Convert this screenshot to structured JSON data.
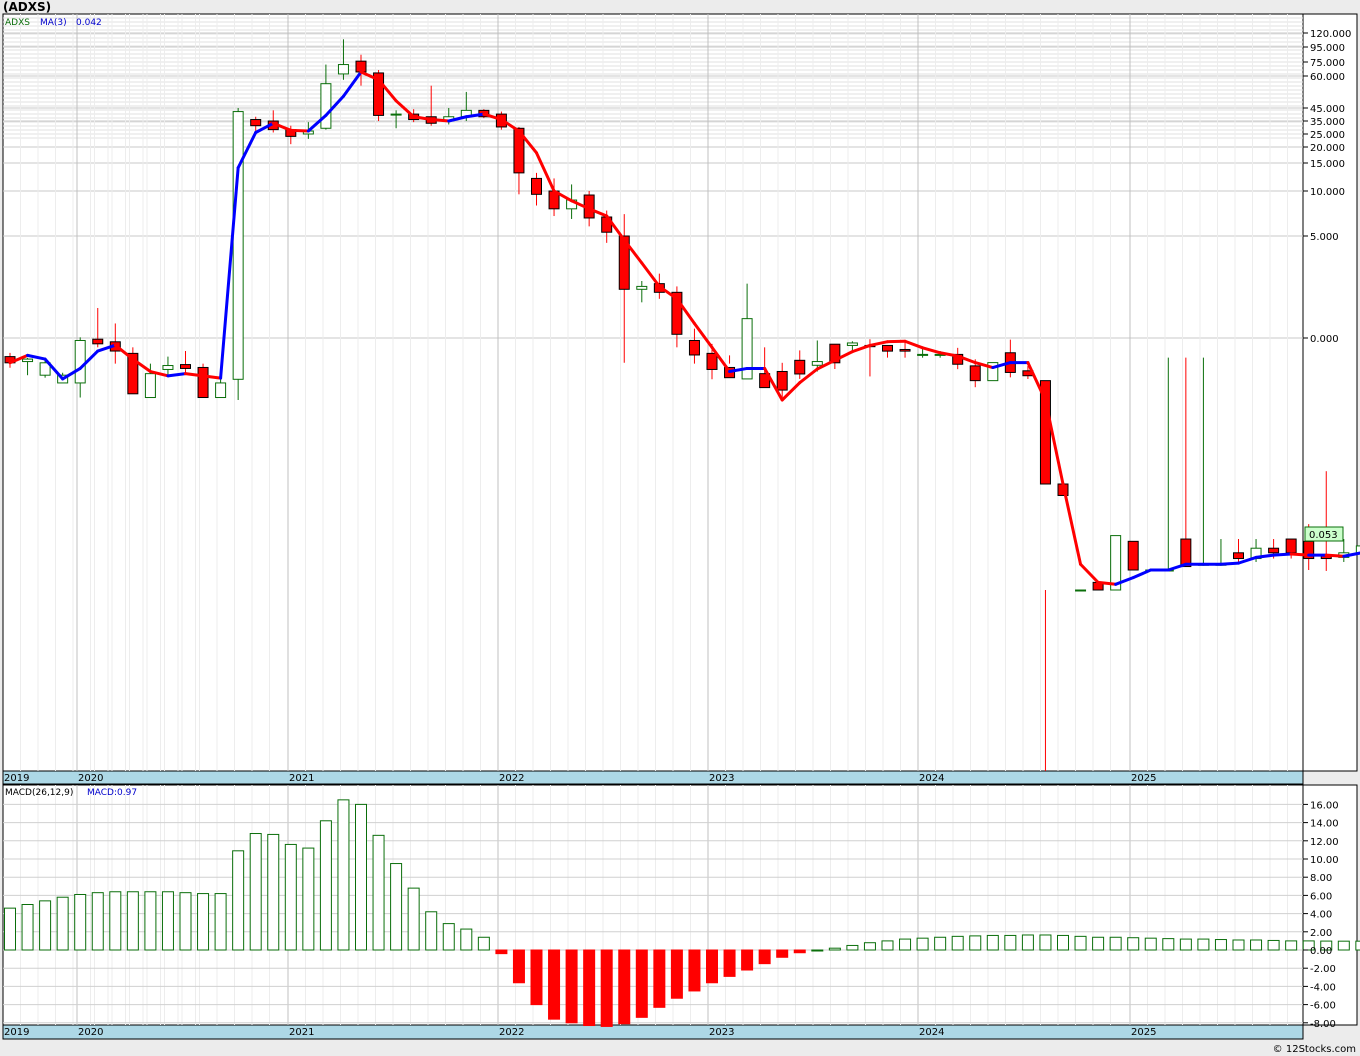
{
  "title": "(ADXS)",
  "footer": "© 12Stocks.com",
  "price_panel": {
    "legend_symbol": "ADXS",
    "legend_ma": "MA(3)",
    "legend_ma_value": "0.042",
    "last_price_label": "0.053",
    "y_tick_labels": [
      "120.000",
      "95.000",
      "75.000",
      "60.000",
      "45.000",
      "35.000",
      "25.000",
      "20.000",
      "15.000",
      "10.000",
      "5.000",
      "0.000"
    ],
    "x_year_labels": [
      "2019",
      "2020",
      "2021",
      "2022",
      "2023",
      "2024",
      "2025"
    ]
  },
  "macd_panel": {
    "legend": "MACD(26,12,9)",
    "legend_value": "MACD:0.97",
    "y_tick_labels": [
      "16.00",
      "14.00",
      "12.00",
      "10.00",
      "8.00",
      "6.00",
      "4.00",
      "2.00",
      "0.00",
      "-2.00",
      "-4.00",
      "-6.00",
      "-8.00"
    ],
    "x_year_labels": [
      "2019",
      "2020",
      "2021",
      "2022",
      "2023",
      "2024",
      "2025"
    ]
  },
  "colors": {
    "up": "#0a6e0a",
    "down": "#ff0000",
    "ma_up": "#0000ff",
    "ma_down": "#ff0000",
    "axis_band": "#add8e6",
    "grid": "#c0c0c0",
    "last_price_bg": "#ccffcc"
  },
  "chart_data": [
    {
      "type": "candlestick",
      "title": "(ADXS)",
      "scale": "log",
      "period": "monthly",
      "x_start": "2018-11",
      "overlay": "MA(3)",
      "series": [
        {
          "name": "ADXS",
          "ohlc": [
            [
              0.2,
              0.24,
              0.12,
              0.15
            ],
            [
              0.17,
              0.3,
              0.16,
              0.19
            ],
            [
              0.2,
              0.32,
              0.18,
              0.3
            ],
            [
              0.3,
              0.55,
              0.28,
              0.52
            ],
            [
              0.52,
              1.05,
              0.48,
              1.0
            ],
            [
              1.02,
              1.65,
              0.9,
              0.95
            ],
            [
              0.98,
              1.3,
              0.7,
              0.85
            ],
            [
              0.82,
              0.9,
              0.38,
              0.45
            ],
            [
              0.48,
              0.7,
              0.4,
              0.6
            ],
            [
              0.64,
              0.78,
              0.58,
              0.68
            ],
            [
              0.69,
              0.85,
              0.6,
              0.65
            ],
            [
              0.66,
              0.7,
              0.44,
              0.48
            ],
            [
              0.48,
              0.56,
              0.42,
              0.52
            ],
            [
              0.55,
              45.0,
              0.5,
              42.0
            ],
            [
              36.0,
              38.0,
              27.0,
              31.0
            ],
            [
              35.0,
              43.0,
              26.0,
              28.0
            ],
            [
              28.0,
              31.0,
              21.0,
              24.0
            ],
            [
              25.0,
              34.0,
              23.0,
              27.0
            ],
            [
              29.0,
              72.0,
              28.0,
              56.0
            ],
            [
              62.0,
              108.0,
              58.0,
              72.0
            ],
            [
              76.0,
              84.0,
              55.0,
              64.0
            ],
            [
              63.0,
              66.0,
              35.0,
              39.0
            ],
            [
              40.0,
              43.0,
              29.0,
              40.0
            ],
            [
              40.0,
              44.0,
              34.0,
              36.0
            ],
            [
              38.0,
              55.0,
              31.0,
              33.0
            ],
            [
              35.0,
              45.0,
              32.0,
              38.0
            ],
            [
              38.0,
              52.0,
              35.0,
              43.0
            ],
            [
              43.0,
              44.0,
              37.0,
              38.0
            ],
            [
              40.0,
              42.0,
              28.0,
              30.0
            ],
            [
              29.0,
              30.0,
              9.5,
              13.0
            ],
            [
              12.0,
              13.0,
              8.0,
              9.5
            ],
            [
              10.0,
              12.0,
              6.8,
              7.6
            ],
            [
              7.6,
              11.0,
              6.5,
              8.7
            ],
            [
              9.4,
              10.0,
              5.8,
              6.6
            ],
            [
              6.7,
              7.4,
              4.5,
              5.3
            ],
            [
              5.0,
              7.0,
              0.2,
              2.2
            ],
            [
              2.2,
              2.5,
              1.8,
              2.3
            ],
            [
              2.4,
              2.8,
              1.9,
              2.1
            ],
            [
              2.1,
              2.3,
              0.9,
              1.1
            ],
            [
              1.0,
              1.2,
              0.7,
              0.8
            ],
            [
              0.82,
              0.95,
              0.55,
              0.64
            ],
            [
              0.66,
              0.7,
              0.14,
              0.32
            ],
            [
              0.33,
              2.4,
              0.22,
              1.4
            ],
            [
              0.6,
              0.9,
              0.34,
              0.4
            ],
            [
              0.42,
              0.49,
              0.2,
              0.27
            ],
            [
              0.29,
              0.33,
              0.1,
              0.18
            ],
            [
              0.19,
              0.27,
              0.02,
              0.22
            ],
            [
              0.2,
              0.25,
              -0.1,
              0.05
            ],
            [
              0.04,
              0.1,
              -0.02,
              0.06
            ],
            [
              0.07,
              0.31,
              0.01,
              0.06
            ],
            [
              0.06,
              0.08,
              -0.12,
              -0.08
            ],
            [
              -0.07,
              -0.02,
              -0.12,
              -0.08
            ],
            [
              -0.1,
              -0.06,
              -0.12,
              -0.1
            ],
            [
              -0.1,
              -0.08,
              -0.12,
              -0.1
            ],
            [
              -0.1,
              -0.06,
              -0.19,
              -0.16
            ],
            [
              -0.17,
              -0.13,
              -0.3,
              -0.26
            ],
            [
              -0.26,
              0.25,
              -0.25,
              -0.15
            ],
            [
              -0.09,
              -0.01,
              -0.24,
              -0.21
            ],
            [
              -0.2,
              -0.17,
              -0.25,
              -0.23
            ],
            [
              -0.26,
              -0.26,
              -0.8,
              -0.9
            ],
            [
              -0.9,
              -0.9,
              -1.0,
              -1.0
            ],
            [
              -2.7,
              -2.7,
              -2.7,
              -2.7
            ],
            [
              -2.3,
              -2.3,
              -3.2,
              -3.2
            ],
            [
              -3.2,
              -1.35,
              -3.2,
              -1.35
            ],
            [
              -1.4,
              -1.4,
              -1.65,
              -1.65
            ],
            [
              -1.65,
              -1.65,
              -1.65,
              -1.65
            ],
            [
              -1.65,
              -0.12,
              -1.65,
              -1.65
            ],
            [
              -1.38,
              -0.12,
              -1.62,
              -1.62
            ],
            [
              -1.6,
              -0.12,
              -1.6,
              -1.6
            ],
            [
              -1.6,
              -1.38,
              -1.6,
              -1.6
            ],
            [
              -1.5,
              -1.38,
              -1.58,
              -1.55
            ],
            [
              -1.55,
              -1.38,
              -1.58,
              -1.46
            ],
            [
              -1.46,
              -1.38,
              -1.55,
              -1.5
            ],
            [
              -1.38,
              -1.38,
              -1.55,
              -1.5
            ],
            [
              -1.4,
              -1.25,
              -1.65,
              -1.55
            ],
            [
              -1.52,
              -0.82,
              -1.7,
              -1.55
            ],
            [
              -1.54,
              -1.38,
              -1.58,
              -1.5
            ],
            [
              -1.5,
              -1.38,
              -1.58,
              -1.44
            ]
          ]
        }
      ],
      "ma3": [
        0.2,
        0.14,
        0.17,
        0.33,
        0.65,
        0.85,
        0.93,
        0.75,
        0.62,
        0.58,
        0.6,
        0.58,
        0.56,
        14.0,
        26.0,
        33.0,
        27.5,
        27.0,
        39.0,
        50.0,
        64.0,
        58.0,
        48.0,
        38.0,
        36.0,
        35.0,
        38.0,
        40.0,
        36.0,
        27.0,
        18.0,
        10.0,
        8.6,
        7.6,
        6.8,
        4.7,
        3.3,
        2.3,
        1.9,
        1.3,
        0.9,
        0.62,
        0.65,
        0.65,
        0.5,
        0.36,
        0.25,
        0.18,
        0.11,
        0.06,
        0.03,
        -0.02,
        -0.06,
        -0.09,
        -0.11,
        -0.15,
        -0.18,
        -0.15,
        -0.15,
        -0.38,
        -0.9,
        -1.6,
        -2.3,
        -2.4,
        -2.05,
        -1.65,
        -1.65,
        -1.6,
        -1.6,
        -1.6,
        -1.59,
        -1.54,
        -1.52,
        -1.51,
        -1.52,
        -1.52,
        -1.53,
        -1.5
      ]
    },
    {
      "type": "bar",
      "title": "MACD(26,12,9)",
      "series": [
        {
          "name": "MACD",
          "values": [
            4.6,
            5.0,
            5.4,
            5.8,
            6.1,
            6.3,
            6.4,
            6.4,
            6.4,
            6.4,
            6.3,
            6.2,
            6.2,
            10.9,
            12.8,
            12.7,
            11.6,
            11.2,
            14.2,
            16.5,
            16.0,
            12.6,
            9.5,
            6.8,
            4.2,
            2.9,
            2.3,
            1.4,
            -0.4,
            -3.6,
            -6.0,
            -7.6,
            -8.0,
            -8.3,
            -8.4,
            -8.1,
            -7.4,
            -6.3,
            -5.3,
            -4.5,
            -3.6,
            -2.9,
            -2.2,
            -1.5,
            -0.8,
            -0.3,
            0.0,
            0.2,
            0.5,
            0.8,
            1.0,
            1.2,
            1.3,
            1.4,
            1.5,
            1.55,
            1.6,
            1.6,
            1.65,
            1.65,
            1.6,
            1.5,
            1.4,
            1.4,
            1.35,
            1.3,
            1.25,
            1.2,
            1.2,
            1.15,
            1.1,
            1.1,
            1.05,
            1.0,
            1.0,
            0.98,
            0.97,
            0.97
          ]
        }
      ],
      "ylim": [
        -8,
        16
      ]
    }
  ]
}
